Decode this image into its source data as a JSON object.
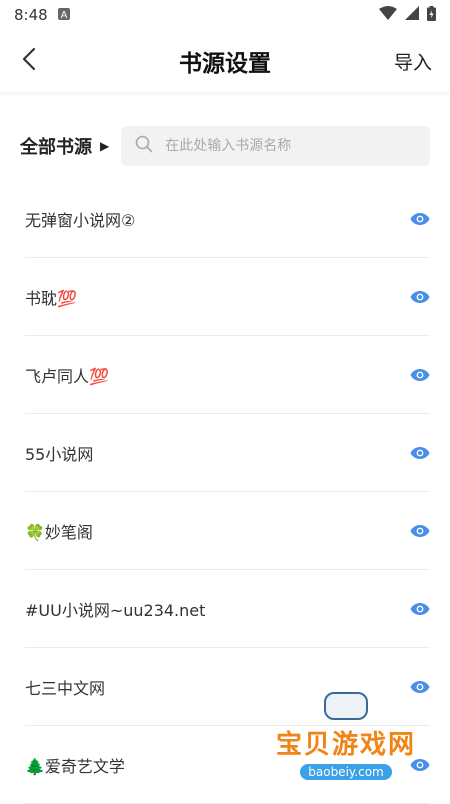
{
  "status": {
    "time": "8:48",
    "notif_icon": "a-icon"
  },
  "header": {
    "title": "书源设置",
    "import_label": "导入"
  },
  "filter": {
    "label": "全部书源",
    "arrow": "▶",
    "search_placeholder": "在此处输入书源名称"
  },
  "sources": [
    {
      "name": "无弹窗小说网②"
    },
    {
      "name": "书耽💯"
    },
    {
      "name": "飞卢同人💯"
    },
    {
      "name": "55小说网"
    },
    {
      "name": "🍀妙笔阁"
    },
    {
      "name": "#UU小说网~uu234.net"
    },
    {
      "name": "七三中文网"
    },
    {
      "name": "🌲爱奇艺文学"
    }
  ],
  "watermark": {
    "title": "宝贝游戏网",
    "url": "baobeiy.com"
  },
  "colors": {
    "eye": "#4a8fe7",
    "search_bg": "#f2f2f2"
  }
}
